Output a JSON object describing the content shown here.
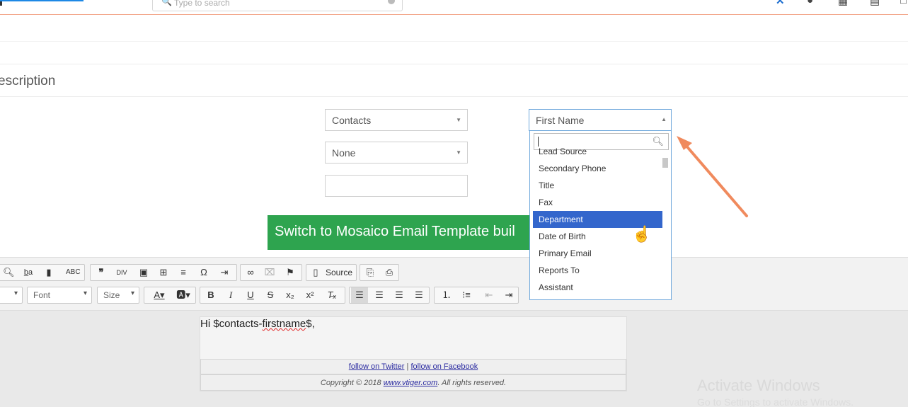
{
  "topbar": {
    "search_placeholder": "Type to search"
  },
  "section": {
    "title": "escription"
  },
  "fields": {
    "module_select": "Contacts",
    "second_select": "None",
    "text_value": "",
    "field_select": "First Name"
  },
  "dropdown": {
    "items": [
      "Lead Source",
      "Secondary Phone",
      "Title",
      "Fax",
      "Department",
      "Date of Birth",
      "Primary Email",
      "Reports To",
      "Assistant"
    ],
    "selected": "Department"
  },
  "mosaico_button": "Switch to Mosaico Email Template buil",
  "toolbar": {
    "source_label": "Source",
    "font_label": "Font",
    "size_label": "Size"
  },
  "email": {
    "greeting_prefix": "Hi $contacts-",
    "greeting_var": "firstname",
    "greeting_suffix": "$,",
    "twitter": "follow on Twitter",
    "sep": "|",
    "facebook": "follow on Facebook",
    "copy_prefix": "Copyright © 2018",
    "site": "www.vtiger.com",
    "copy_suffix": ". All rights reserved."
  },
  "watermark": {
    "title": "Activate Windows",
    "sub": "Go to Settings to activate Windows."
  },
  "colors": {
    "accent": "#2ea44f",
    "selection": "#3366cc",
    "arrow": "#f08a5d"
  }
}
